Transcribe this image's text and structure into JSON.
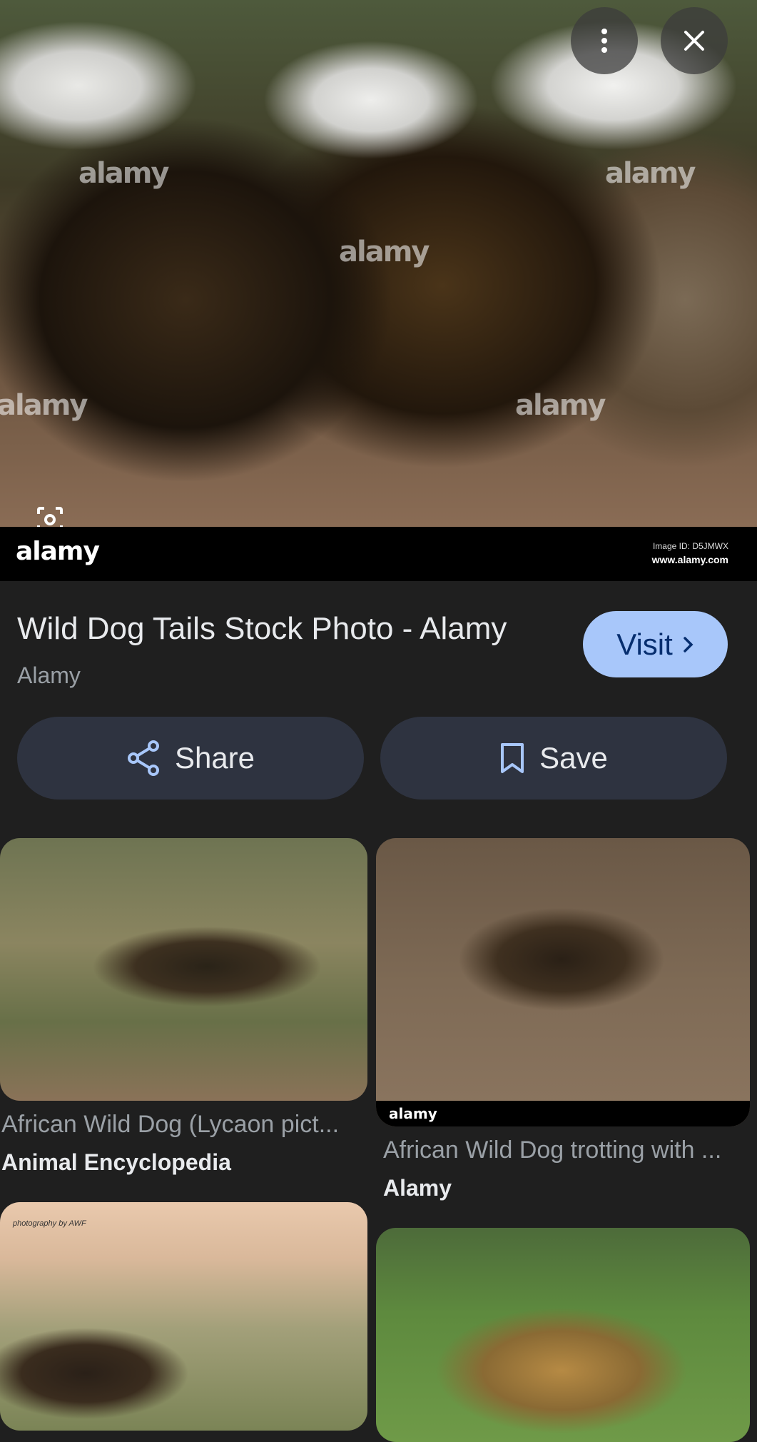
{
  "hero": {
    "watermark": "alamy",
    "logo": "alamy",
    "image_id": "Image ID: D5JMWX",
    "url": "www.alamy.com"
  },
  "icons": {
    "more": "more-vert-icon",
    "close": "close-icon",
    "lens": "lens-icon",
    "share": "share-icon",
    "save": "bookmark-icon",
    "visit_chevron": "chevron-right-icon"
  },
  "result": {
    "title": "Wild Dog Tails Stock Photo - Alamy",
    "source": "Alamy",
    "visit_label": "Visit",
    "share_label": "Share",
    "save_label": "Save"
  },
  "related": [
    {
      "caption": "African Wild Dog (Lycaon pict...",
      "site": "Animal Encyclopedia"
    },
    {
      "caption": "African Wild Dog trotting with ...",
      "site": "Alamy",
      "logo": "alamy"
    },
    {
      "badge": "photography by AWF"
    },
    {}
  ],
  "colors": {
    "background": "#1f1f1f",
    "visit_button": "#a8c7fa",
    "pill_button": "#2e3340",
    "accent_icon": "#a8c7fa"
  }
}
